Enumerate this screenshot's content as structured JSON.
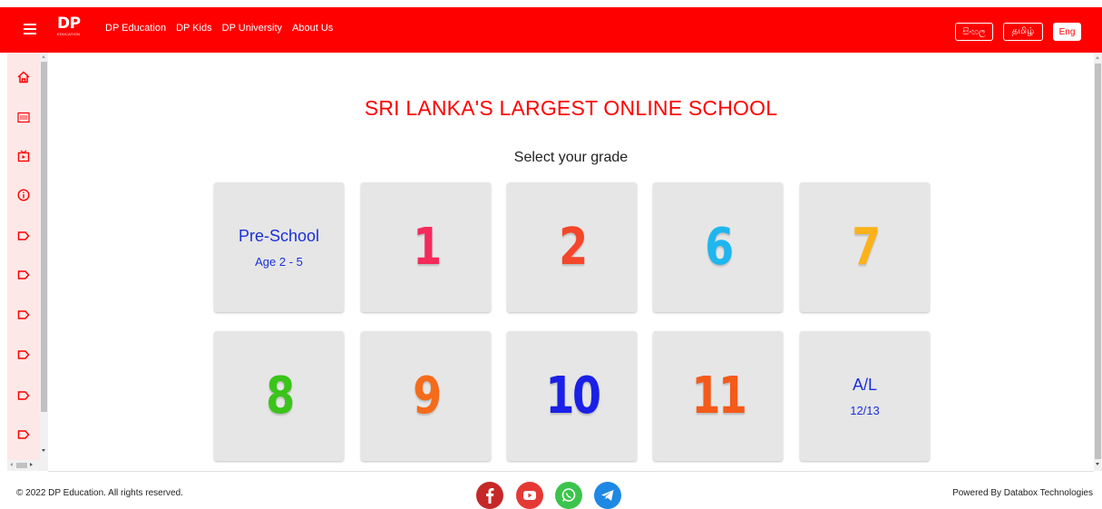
{
  "header": {
    "logo_main": "DP",
    "logo_sub": "EDUCATION",
    "nav": [
      "DP Education",
      "DP Kids",
      "DP University",
      "About Us"
    ],
    "languages": [
      "සිංහල",
      "தமிழ்",
      "Eng"
    ],
    "active_language": "Eng",
    "background_color": "#fe0000"
  },
  "sidebar": {
    "icons": [
      "home-icon",
      "calendar-icon",
      "tv-icon",
      "info-icon",
      "tag-icon",
      "tag-icon",
      "tag-icon",
      "tag-icon",
      "tag-icon",
      "tag-icon"
    ]
  },
  "main": {
    "headline": "SRI LANKA'S LARGEST ONLINE SCHOOL",
    "subheading": "Select your grade",
    "grades": [
      {
        "label": "Pre-School",
        "sub": "Age 2 - 5"
      },
      {
        "label": "1",
        "color": "#f42a5b"
      },
      {
        "label": "2",
        "color": "#f4462a"
      },
      {
        "label": "6",
        "color": "#1fb6f0"
      },
      {
        "label": "7",
        "color": "#fbb21a"
      },
      {
        "label": "8",
        "color": "#3ac41a"
      },
      {
        "label": "9",
        "color": "#f46c1a"
      },
      {
        "label": "10",
        "color": "#1a20e6"
      },
      {
        "label": "11",
        "color": "#f45a1a"
      },
      {
        "label": "A/L",
        "sub": "12/13"
      }
    ]
  },
  "footer": {
    "copyright": "© 2022 DP Education. All rights reserved.",
    "powered_by": "Powered By Databox Technologies",
    "social": [
      {
        "name": "facebook-icon",
        "color": "#c62828"
      },
      {
        "name": "youtube-icon",
        "color": "#e53935"
      },
      {
        "name": "whatsapp-icon",
        "color": "#3bc44b"
      },
      {
        "name": "telegram-icon",
        "color": "#1e88e5"
      }
    ]
  }
}
